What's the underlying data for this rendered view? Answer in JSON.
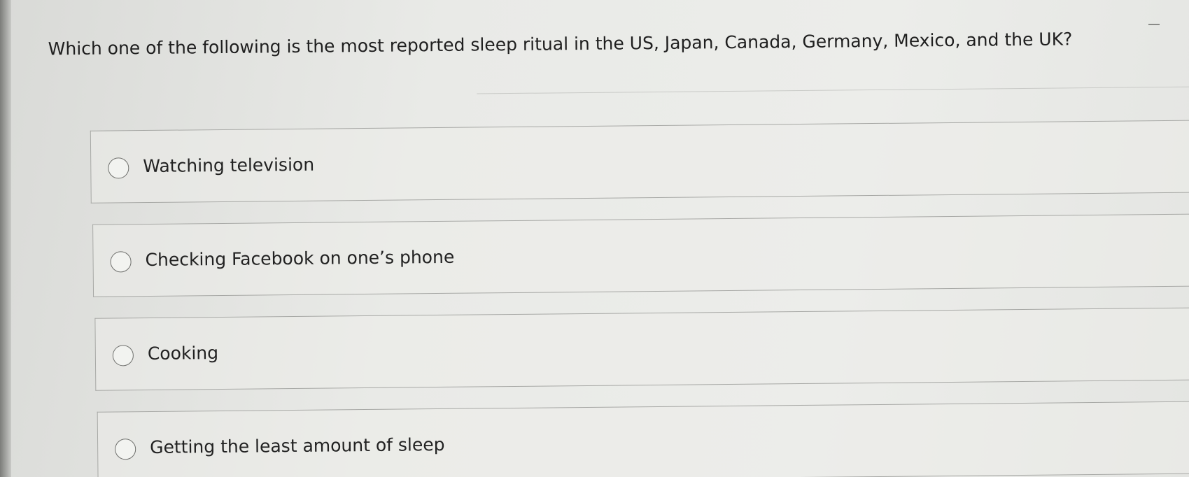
{
  "question": {
    "text": "Which one of the following is the most reported sleep ritual in the US, Japan, Canada, Germany, Mexico, and the UK?"
  },
  "options": [
    {
      "label": "Watching television",
      "selected": false
    },
    {
      "label": "Checking Facebook on one’s phone",
      "selected": false
    },
    {
      "label": "Cooking",
      "selected": false
    },
    {
      "label": "Getting the least amount of sleep",
      "selected": false
    }
  ],
  "colors": {
    "background": "#e9eae7",
    "border": "#a7a8a5",
    "text": "#222222"
  }
}
